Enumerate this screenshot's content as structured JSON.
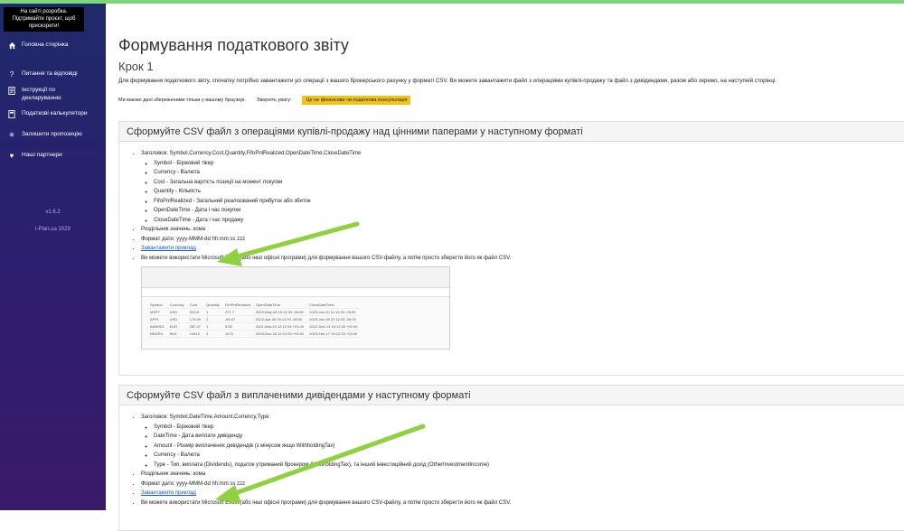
{
  "promo": "На сайті розробка. Підтримайте проєкт, щоб прискорити!",
  "sidebar": {
    "items": [
      {
        "icon": "home-icon",
        "label": "Головна сторінка"
      },
      {
        "icon": "question-icon",
        "label": "Питання та відповіді"
      },
      {
        "icon": "document-icon",
        "label": "Інструкції по декларуванню"
      },
      {
        "icon": "calculator-icon",
        "label": "Податкові калькулятори"
      },
      {
        "icon": "lightbulb-icon",
        "label": "Залишити пропозицію"
      },
      {
        "icon": "heart-icon",
        "label": "Наші партнери"
      }
    ],
    "version": "v1.6.2",
    "footer": "i-Plan.ua 2029"
  },
  "main": {
    "title": "Формування податкового звіту",
    "step": "Крок 1",
    "intro": "Для формування податкового звіту, спочатку потрібно завантажити усі операції з вашого брокерського рахунку у форматі CSV. Ви можете завантажити файл з операціями купівлі-продажу та файл з дивідендами, разом або окремо, на наступній сторінці.",
    "note1": "Ми маємо дані збереженими тільки у вашому браузері.",
    "note2": "Зверніть увагу:",
    "badge": "Це не фінансова чи податкова консультація"
  },
  "section1": {
    "heading": "Сформуйте CSV файл з операціями купівлі-продажу над цінними паперами у наступному форматі",
    "header_line": "Заголовок: Symbol,Currency,Cost,Quantity,FifoPnlRealized,OpenDateTime,CloseDateTime",
    "fields": [
      "Symbol - Біржовий тікер",
      "Currency - Валюта",
      "Cost - Загальна вартість позиції на момент покупки",
      "Quantity - Кількість",
      "FifoPnlRealized - Загальний реалізований прибуток або збиток",
      "OpenDateTime - Дата і час покупки",
      "CloseDateTime - Дата і час продажу"
    ],
    "separator": "Роздільник значень: кома",
    "date_format": "Формат дати: yyyy-MMM-dd hh:mm:ss zzz",
    "download": "Завантажити приклад",
    "excel_note": "Ви можете використати Microsoft Excel (або інші офісні програми) для формування вашого CSV-файлу, а потім просто зберегти його як файл CSV."
  },
  "excel": {
    "headers": [
      "Symbol",
      "Currency",
      "Cost",
      "Quantity",
      "FifoPnlRealized",
      "OpenDateTime",
      "CloseDateTime"
    ],
    "rows": [
      [
        "MSFT",
        "USD",
        "923.8",
        "1",
        "277.7",
        "2020-May-08 15:12:33 -05:00",
        "2023-Jan-20 11:12:33 -05:00"
      ],
      [
        "APPL",
        "USD",
        "178.09",
        "2",
        "-80.67",
        "2022-Apr-08 15:12:33 -05:00",
        "2023-Jan-08 22:12:33 -05:00"
      ],
      [
        "AMWSG",
        "EUR",
        "287.47",
        "1",
        "3.55",
        "2021-Mar-19 12:12:33 +01:00",
        "2022-Dec-13 10:12:33 +01:00"
      ],
      [
        "NNGRX",
        "SKK",
        "14615",
        "3",
        "1475",
        "2020-Dec-18 12:12:33 +03:00",
        "2023-Feb-17 15:12:33 +03:00"
      ]
    ]
  },
  "section2": {
    "heading": "Сформуйте CSV файл з виплаченими дивідендами у наступному форматі",
    "header_line": "Заголовок: Symbol,DateTime,Amount,Currency,Type",
    "fields": [
      "Symbol - Біржовий тікер",
      "DateTime - Дата виплати дивіденду",
      "Amount - Розмір виплачених дивідендів (з мінусом якщо WithholdingTax)",
      "Currency - Валюта",
      "Type - Тип, виплата (Dividends), податок утриманий брокером (WithholdingTax), та інший інвестиційний дохід (OtherInvestmentIncome)"
    ],
    "separator": "Роздільник значень: кома",
    "date_format": "Формат дати: yyyy-MMM-dd hh:mm:ss zzz",
    "download": "Завантажити приклад",
    "excel_note": "Ви можете використати Microsoft Excel (або інші офісні програми) для формування вашого CSV-файлу, а потім просто зберегти його як файл CSV."
  }
}
